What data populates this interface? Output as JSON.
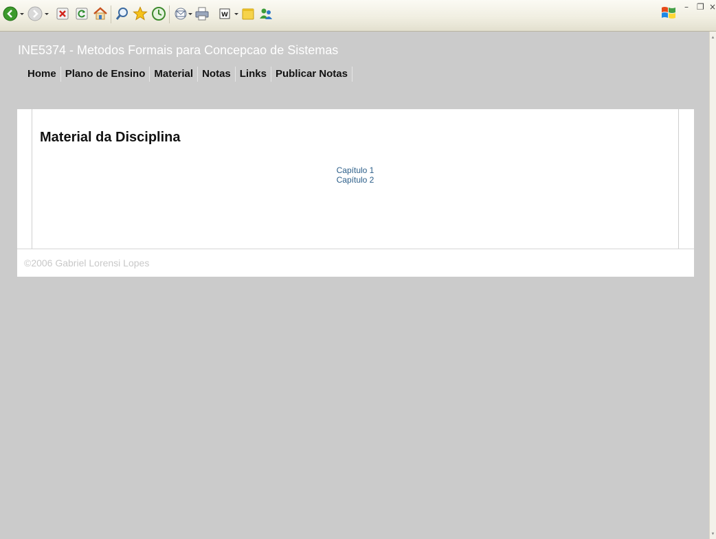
{
  "header": {
    "site_title": "INE5374 - Metodos Formais para Concepcao de Sistemas"
  },
  "nav": {
    "items": [
      {
        "label": "Home"
      },
      {
        "label": "Plano de Ensino"
      },
      {
        "label": "Material"
      },
      {
        "label": "Notas"
      },
      {
        "label": "Links"
      },
      {
        "label": "Publicar Notas"
      }
    ]
  },
  "main": {
    "title": "Material da Disciplina",
    "materials": [
      {
        "label": "Capítulo 1"
      },
      {
        "label": "Capítulo 2"
      }
    ]
  },
  "footer": {
    "copyright": "©2006 Gabriel Lorensi Lopes"
  },
  "toolbar": {
    "icons": [
      "back-icon",
      "forward-icon",
      "stop-icon",
      "refresh-icon",
      "home-icon",
      "search-icon",
      "favorites-icon",
      "history-icon",
      "mail-icon",
      "print-icon",
      "word-icon",
      "note-icon",
      "messenger-icon"
    ]
  },
  "colors": {
    "page_background": "#cbcbcb",
    "link": "#2a5d88",
    "footer_text": "#c8c8c8"
  }
}
